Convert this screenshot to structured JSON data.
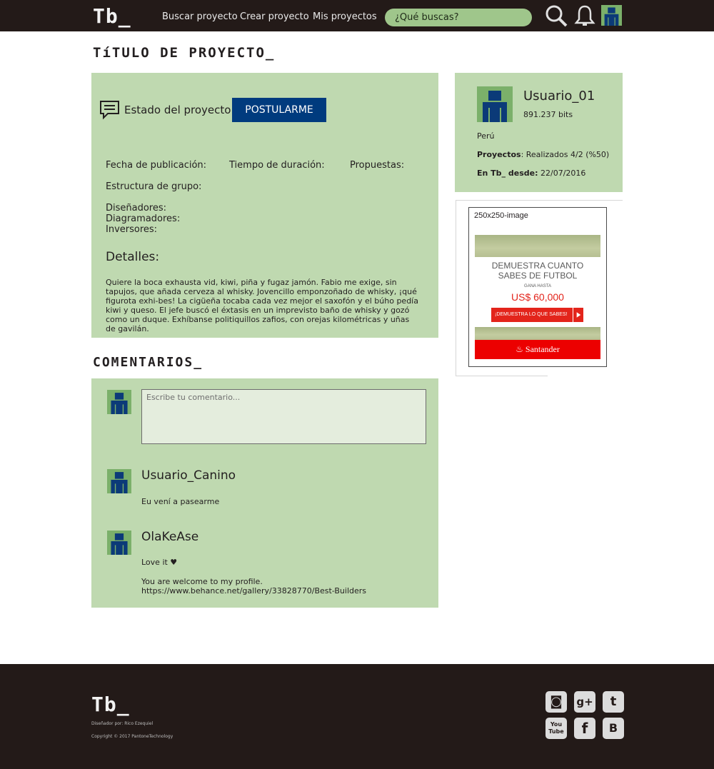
{
  "header": {
    "logo": "Tb_",
    "nav": [
      "Buscar proyecto",
      "Crear proyecto",
      "Mis proyectos"
    ],
    "search_placeholder": "¿Qué buscas?",
    "icons": [
      "search-icon",
      "bell-icon",
      "user-avatar"
    ]
  },
  "project": {
    "title": "TíTULO DE PROYECTO_",
    "status_label": "Estado del proyecto",
    "apply_label": "POSTULARME",
    "fields": {
      "published": "Fecha de publicación:",
      "duration": "Tiempo de duración:",
      "proposals": "Propuestas:",
      "group": "Estructura de grupo:",
      "designers": "Diseñadores:",
      "layout": "Diagramadores:",
      "investors": "Inversores:"
    },
    "details_title": "Detalles:",
    "details_text": "Quiere la boca exhausta vid, kiwi, piña y fugaz jamón. Fabio me exige, sin tapujos, que añada cerveza al whisky. Jovencillo emponzoñado de whisky, ¡qué figurota exhi-bes! La cigüeña tocaba cada vez mejor el saxofón y el búho pedía kiwi y queso. El jefe buscó el éxtasis en un imprevisto baño de whisky y gozó como un duque. Exhíbanse politiquillos zafios, con orejas kilométricas y uñas de gavilán."
  },
  "user": {
    "name": "Usuario_01",
    "bits": "891.237 bits",
    "country": "Perú",
    "projects_label": "Proyectos",
    "projects_value": ": Realizados 4/2 (%50)",
    "since_label": "En Tb_ desde:",
    "since_value": " 22/07/2016"
  },
  "ad": {
    "size_label": "250x250-image",
    "headline_1": "DEMUESTRA CUANTO",
    "headline_2": "SABES DE FUTBOL",
    "small": "GANA HASTA",
    "amount": "US$ 60,000",
    "cta": "¡DEMUESTRA LO QUE SABES!",
    "brand": "Santander"
  },
  "comments": {
    "section_title": "COMENTARIOS_",
    "input_placeholder": "Escribe tu comentario...",
    "items": [
      {
        "author": "Usuario_Canino",
        "lines": [
          "Eu vení a pasearme"
        ]
      },
      {
        "author": "OlaKeAse",
        "lines": [
          "Love it ♥",
          "You are welcome to my profile.",
          "https://www.behance.net/gallery/33828770/Best-Builders"
        ]
      }
    ]
  },
  "footer": {
    "logo": "Tb_",
    "designer": "Diseñador por: Rico Ezequiel",
    "copyright": "Copyright © 2017 PantoneTechnology",
    "social": [
      {
        "name": "instagram-icon",
        "glyph": "◙"
      },
      {
        "name": "google-plus-icon",
        "glyph": "g+"
      },
      {
        "name": "twitter-icon",
        "glyph": "t"
      },
      {
        "name": "youtube-icon",
        "glyph": "You Tube"
      },
      {
        "name": "facebook-icon",
        "glyph": "f"
      },
      {
        "name": "blogger-icon",
        "glyph": "B"
      }
    ]
  },
  "colors": {
    "header_bg": "#231a18",
    "panel_green": "#bfd9b0",
    "search_green": "#9fc68b",
    "button_blue": "#003b7e"
  }
}
